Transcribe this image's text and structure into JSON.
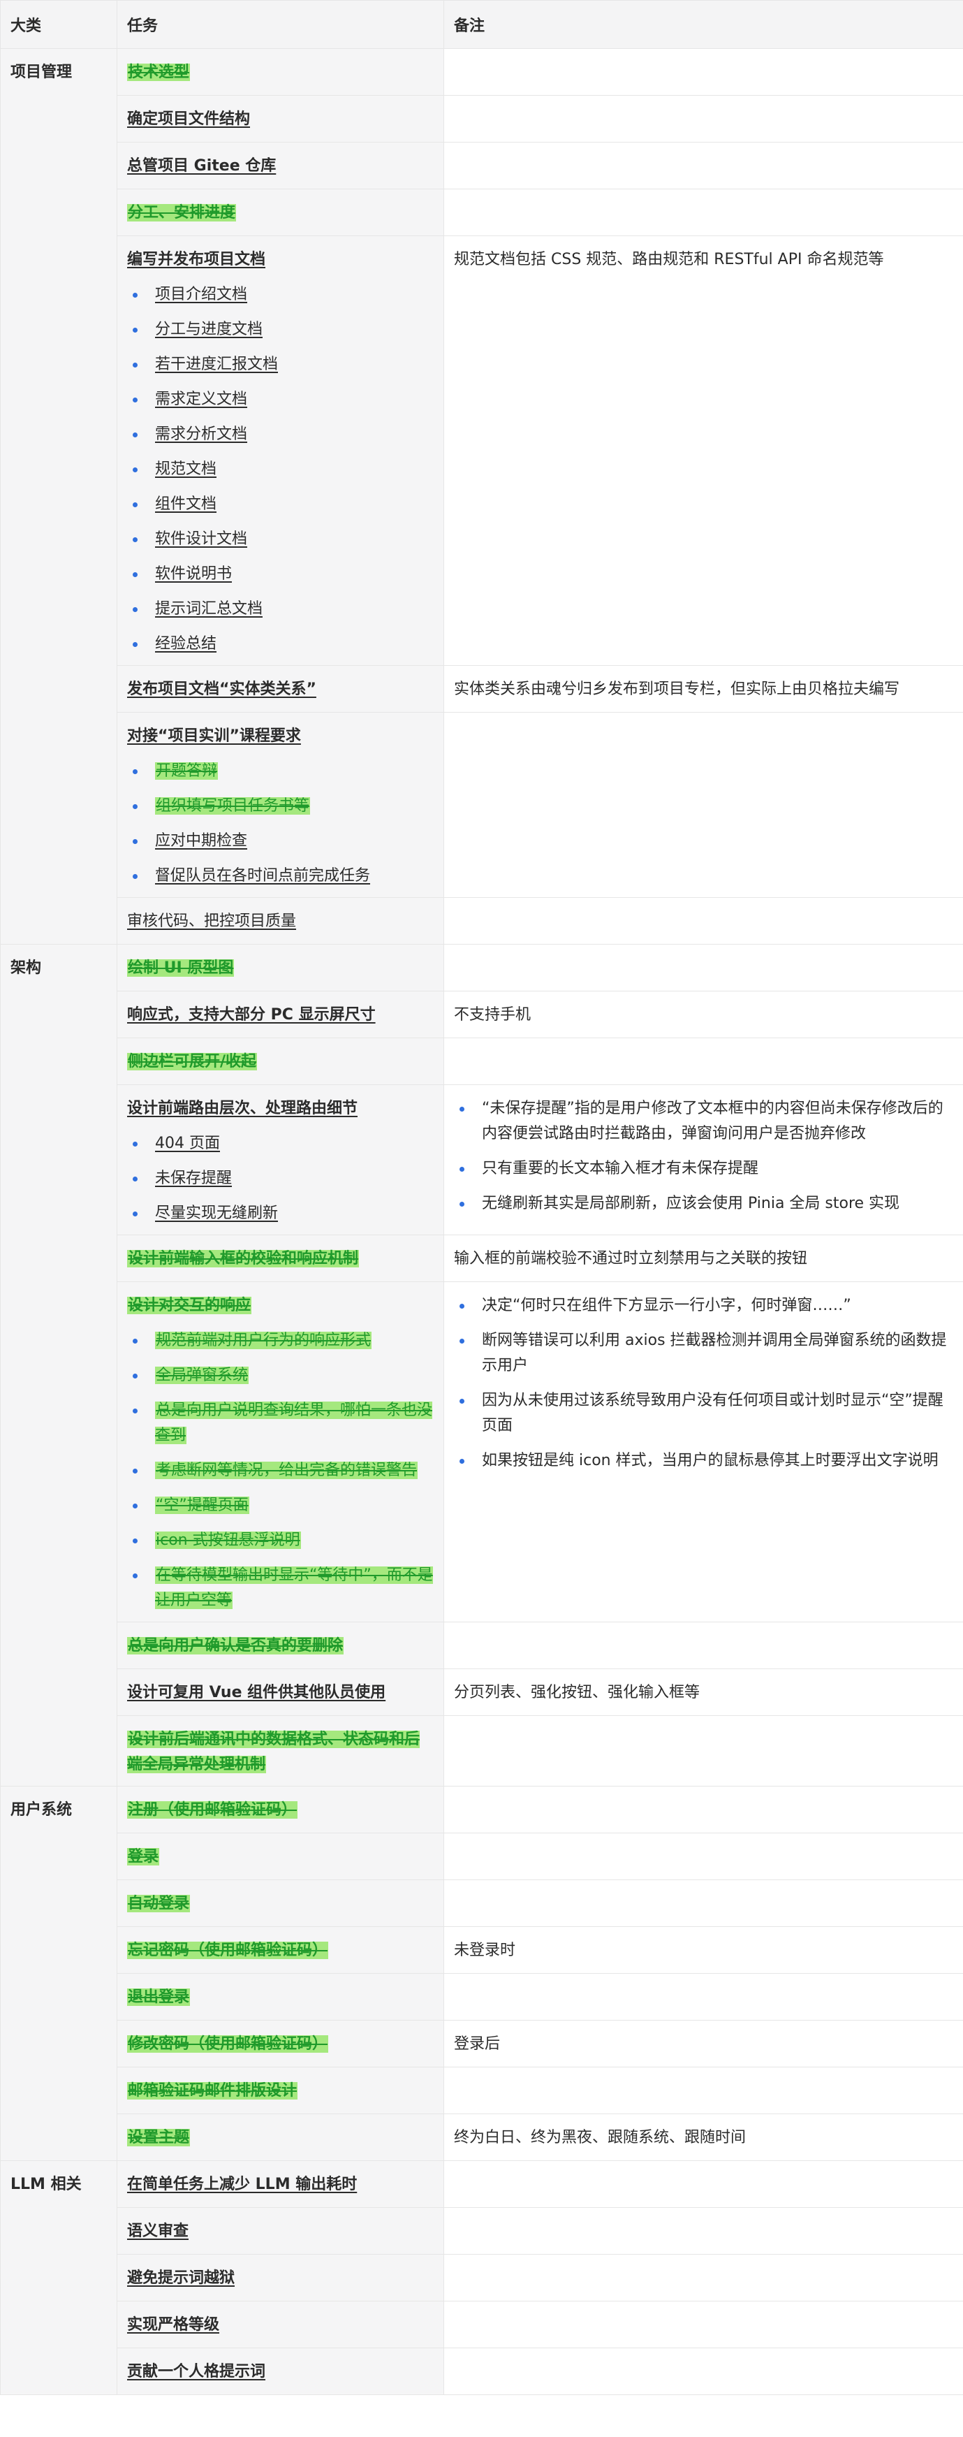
{
  "header": {
    "category": "大类",
    "task": "任务",
    "note": "备注"
  },
  "rows": [
    {
      "cat": "项目管理",
      "task": {
        "text": "技术选型",
        "done": true,
        "bold": true
      },
      "note": ""
    },
    {
      "task": {
        "text": "确定项目文件结构",
        "bold": true
      },
      "note": ""
    },
    {
      "task": {
        "text": "总管项目 Gitee 仓库",
        "bold": true
      },
      "note": ""
    },
    {
      "task": {
        "text": "分工、安排进度",
        "done": true,
        "bold": true
      },
      "note": ""
    },
    {
      "task": {
        "text": "编写并发布项目文档",
        "bold": true,
        "subs": [
          {
            "text": "项目介绍文档"
          },
          {
            "text": "分工与进度文档"
          },
          {
            "text": "若干进度汇报文档"
          },
          {
            "text": "需求定义文档"
          },
          {
            "text": "需求分析文档"
          },
          {
            "text": "规范文档"
          },
          {
            "text": "组件文档"
          },
          {
            "text": "软件设计文档"
          },
          {
            "text": "软件说明书"
          },
          {
            "text": "提示词汇总文档"
          },
          {
            "text": "经验总结"
          }
        ]
      },
      "note": "规范文档包括 CSS 规范、路由规范和 RESTful API 命名规范等"
    },
    {
      "task": {
        "text": "发布项目文档“实体类关系”",
        "bold": true
      },
      "note": "实体类关系由魂兮归乡发布到项目专栏，但实际上由贝格拉夫编写"
    },
    {
      "task": {
        "text": "对接“项目实训”课程要求",
        "bold": true,
        "subs": [
          {
            "text": "开题答辩",
            "done": true
          },
          {
            "text": "组织填写项目任务书等",
            "done": true
          },
          {
            "text": "应对中期检查"
          },
          {
            "text": "督促队员在各时间点前完成任务"
          }
        ]
      },
      "note": ""
    },
    {
      "task": {
        "text": "审核代码、把控项目质量",
        "bold": false
      },
      "note": ""
    },
    {
      "cat": "架构",
      "task": {
        "text": "绘制 UI 原型图",
        "done": true,
        "bold": true
      },
      "note": ""
    },
    {
      "task": {
        "text": "响应式，支持大部分 PC 显示屏尺寸",
        "bold": true
      },
      "note": "不支持手机"
    },
    {
      "task": {
        "text": "侧边栏可展开/收起",
        "done": true,
        "bold": true
      },
      "note": ""
    },
    {
      "task": {
        "text": "设计前端路由层次、处理路由细节",
        "bold": true,
        "subs": [
          {
            "text": "404 页面"
          },
          {
            "text": "未保存提醒"
          },
          {
            "text": "尽量实现无缝刷新"
          }
        ]
      },
      "notes": [
        "“未保存提醒”指的是用户修改了文本框中的内容但尚未保存修改后的内容便尝试路由时拦截路由，弹窗询问用户是否抛弃修改",
        "只有重要的长文本输入框才有未保存提醒",
        "无缝刷新其实是局部刷新，应该会使用 Pinia 全局 store 实现"
      ]
    },
    {
      "task": {
        "text": "设计前端输入框的校验和响应机制",
        "done": true,
        "bold": true
      },
      "note": "输入框的前端校验不通过时立刻禁用与之关联的按钮"
    },
    {
      "task": {
        "text": "设计对交互的响应",
        "done": true,
        "bold": true,
        "subs": [
          {
            "text": "规范前端对用户行为的响应形式",
            "done": true
          },
          {
            "text": "全局弹窗系统",
            "done": true
          },
          {
            "text": "总是向用户说明查询结果，哪怕一条也没查到",
            "done": true
          },
          {
            "text": "考虑断网等情况，给出完备的错误警告",
            "done": true
          },
          {
            "text": "“空”提醒页面",
            "done": true
          },
          {
            "text": "icon 式按钮悬浮说明",
            "done": true
          },
          {
            "text": "在等待模型输出时显示“等待中”，而不是让用户空等",
            "done": true
          }
        ]
      },
      "notes": [
        "决定“何时只在组件下方显示一行小字，何时弹窗……”",
        "断网等错误可以利用 axios 拦截器检测并调用全局弹窗系统的函数提示用户",
        "因为从未使用过该系统导致用户没有任何项目或计划时显示“空”提醒页面",
        "如果按钮是纯 icon 样式，当用户的鼠标悬停其上时要浮出文字说明"
      ]
    },
    {
      "task": {
        "text": "总是向用户确认是否真的要删除",
        "done": true,
        "bold": true
      },
      "note": ""
    },
    {
      "task": {
        "text": "设计可复用 Vue 组件供其他队员使用",
        "bold": true
      },
      "note": "分页列表、强化按钮、强化输入框等"
    },
    {
      "task": {
        "text": "设计前后端通讯中的数据格式、状态码和后端全局异常处理机制",
        "done": true,
        "bold": true
      },
      "note": ""
    },
    {
      "cat": "用户系统",
      "task": {
        "text": "注册（使用邮箱验证码）",
        "done": true,
        "bold": true
      },
      "note": ""
    },
    {
      "task": {
        "text": "登录",
        "done": true,
        "bold": true
      },
      "note": ""
    },
    {
      "task": {
        "text": "自动登录",
        "done": true,
        "bold": true
      },
      "note": ""
    },
    {
      "task": {
        "text": "忘记密码（使用邮箱验证码）",
        "done": true,
        "bold": true
      },
      "note": "未登录时"
    },
    {
      "task": {
        "text": "退出登录",
        "done": true,
        "bold": true
      },
      "note": ""
    },
    {
      "task": {
        "text": "修改密码（使用邮箱验证码）",
        "done": true,
        "bold": true
      },
      "note": "登录后"
    },
    {
      "task": {
        "text": "邮箱验证码邮件排版设计",
        "done": true,
        "bold": true
      },
      "note": ""
    },
    {
      "task": {
        "text": "设置主题",
        "done": true,
        "bold": true
      },
      "note": "终为白日、终为黑夜、跟随系统、跟随时间"
    },
    {
      "cat": "LLM 相关",
      "task": {
        "text": "在简单任务上减少 LLM 输出耗时",
        "bold": true
      },
      "note": ""
    },
    {
      "task": {
        "text": "语义审查",
        "bold": true
      },
      "note": ""
    },
    {
      "task": {
        "text": "避免提示词越狱",
        "bold": true
      },
      "note": ""
    },
    {
      "task": {
        "text": "实现严格等级",
        "bold": true
      },
      "note": ""
    },
    {
      "task": {
        "text": "贡献一个人格提示词",
        "bold": true
      },
      "note": ""
    }
  ],
  "groups": [
    {
      "cat_row": 0,
      "span": 8
    },
    {
      "cat_row": 8,
      "span": 9
    },
    {
      "cat_row": 17,
      "span": 8
    },
    {
      "cat_row": 25,
      "span": 5
    }
  ]
}
